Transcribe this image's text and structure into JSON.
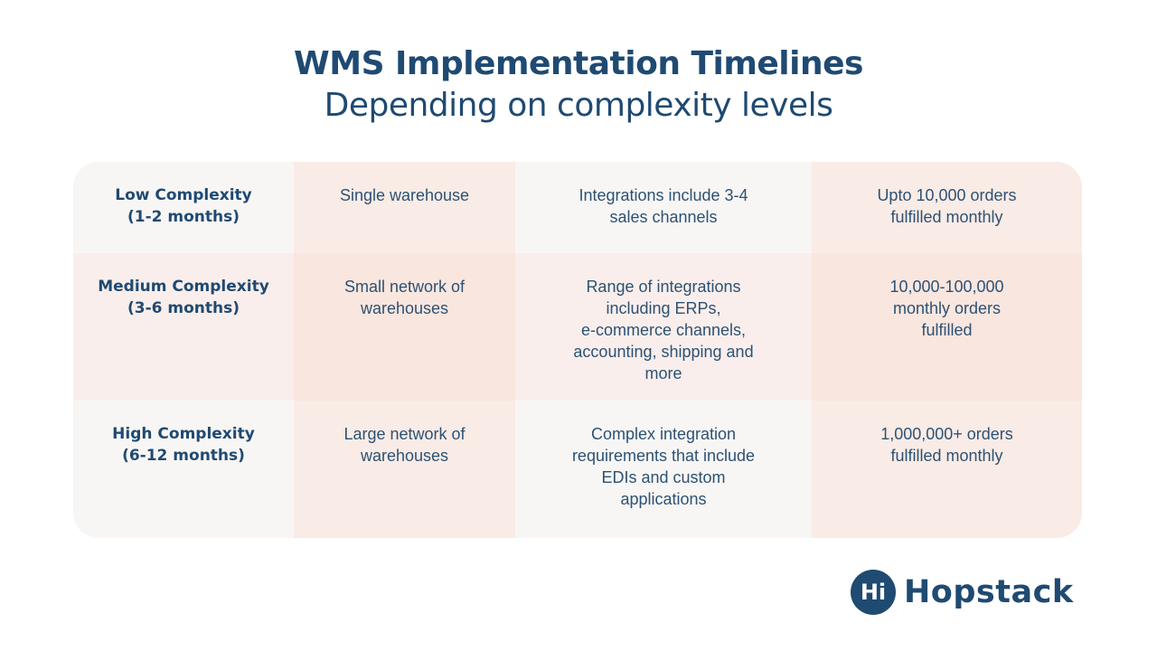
{
  "header": {
    "title": "WMS Implementation Timelines",
    "subtitle": "Depending on complexity levels"
  },
  "table": {
    "rows": [
      {
        "level": [
          "Low Complexity",
          "(1-2 months)"
        ],
        "warehouses": [
          "Single warehouse"
        ],
        "integrations": [
          "Integrations include 3-4",
          "sales channels"
        ],
        "orders": [
          "Upto 10,000 orders",
          "fulfilled monthly"
        ]
      },
      {
        "level": [
          "Medium Complexity",
          "(3-6 months)"
        ],
        "warehouses": [
          "Small network of",
          "warehouses"
        ],
        "integrations": [
          "Range of integrations",
          "including ERPs,",
          "e-commerce channels,",
          "accounting, shipping and",
          "more"
        ],
        "orders": [
          "10,000-100,000",
          "monthly orders",
          "fulfilled"
        ]
      },
      {
        "level": [
          "High Complexity",
          "(6-12 months)"
        ],
        "warehouses": [
          "Large network of",
          "warehouses"
        ],
        "integrations": [
          "Complex integration",
          "requirements that include",
          "EDIs and custom",
          "applications"
        ],
        "orders": [
          "1,000,000+ orders",
          "fulfilled monthly"
        ]
      }
    ]
  },
  "logo": {
    "badge_text": "Hi",
    "name": "Hopstack",
    "icon": "hopstack-logo-icon"
  },
  "colors": {
    "brand": "#1f4a72",
    "cell_neutral": "#f8f6f4",
    "cell_peach": "#f9ebe5"
  }
}
